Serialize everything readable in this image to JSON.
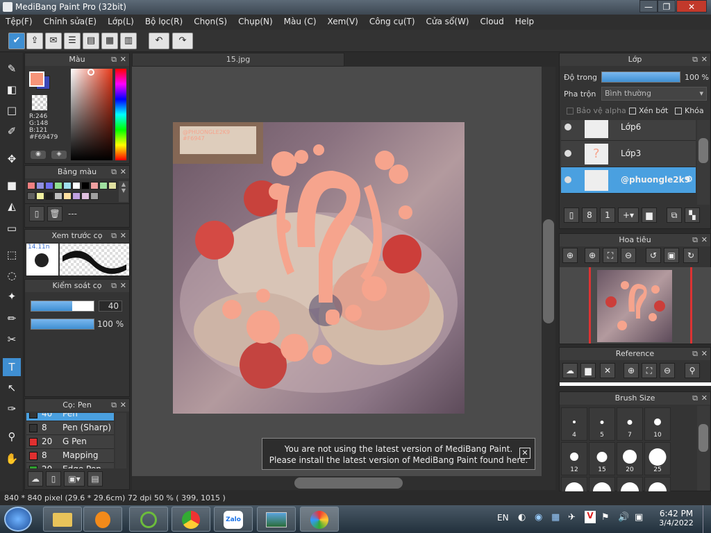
{
  "window": {
    "title": "MediBang Paint Pro (32bit)",
    "min": "—",
    "max": "❐",
    "close": "✕"
  },
  "menu": [
    "Tệp(F)",
    "Chỉnh sửa(E)",
    "Lớp(L)",
    "Bộ lọc(R)",
    "Chọn(S)",
    "Chụp(N)",
    "Màu (C)",
    "Xem(V)",
    "Công cụ(T)",
    "Cửa sổ(W)",
    "Cloud",
    "Help"
  ],
  "document": {
    "tab": "15.jpg",
    "watermark_1": "@PHUONGLE2K9",
    "watermark_2": "#F6947"
  },
  "color_panel": {
    "title": "Màu",
    "r": "R:246",
    "g": "G:148",
    "b": "B:121",
    "hex": "#F69479",
    "fg_color": "#f69479",
    "bg_color": "#3a48b8"
  },
  "palette_panel": {
    "title": "Bảng màu",
    "swatches": [
      "#f08080",
      "#9090e0",
      "#7070f0",
      "#90e090",
      "#a0e0f0",
      "#ffffff",
      "#000000",
      "#f0a0a0",
      "#a0e0a0",
      "#e0e0a0",
      "#606060",
      "#f0f0a0",
      "#202020",
      "#c0c0c0",
      "#ffe0a0",
      "#c0a0e0",
      "#e0c0e0",
      "#a0a0a0"
    ],
    "dash": "---"
  },
  "brush_preview": {
    "title": "Xem trước cọ",
    "size_label": "14.11n"
  },
  "brush_control": {
    "title": "Kiểm soát cọ",
    "size": "40",
    "opacity": "100 %",
    "size_fraction": 0.66,
    "opacity_fraction": 1.0
  },
  "brush_list": {
    "title": "Cọ: Pen",
    "items": [
      {
        "size": "40",
        "name": "Pen",
        "color": "#333333"
      },
      {
        "size": "8",
        "name": "Pen (Sharp)",
        "color": "#333333"
      },
      {
        "size": "20",
        "name": "G Pen",
        "color": "#e03030"
      },
      {
        "size": "8",
        "name": "Mapping Pen",
        "color": "#e03030"
      },
      {
        "size": "20",
        "name": "Edge Pen",
        "color": "#30a030"
      }
    ]
  },
  "layers": {
    "title": "Lớp",
    "opacity_label": "Độ trong",
    "opacity_value": "100 %",
    "opacity_fraction": 1.0,
    "blend_label": "Pha trộn",
    "blend_value": "Bình thường",
    "protect_alpha": "Bảo vệ alpha",
    "clipping": "Xén bớt",
    "lock": "Khóa",
    "items": [
      {
        "name": "Lớp6",
        "selected": false
      },
      {
        "name": "Lớp3",
        "selected": false
      },
      {
        "name": "@phuongle2k9",
        "selected": true
      }
    ]
  },
  "navigator": {
    "title": "Hoa tiêu"
  },
  "reference": {
    "title": "Reference"
  },
  "brush_size": {
    "title": "Brush Size",
    "sizes": [
      "4",
      "5",
      "7",
      "10",
      "12",
      "15",
      "20",
      "25",
      "",
      "",
      "",
      ""
    ]
  },
  "notice": {
    "line1": "You are not using the latest version of MediBang Paint.",
    "line2": "Please install the latest version of MediBang Paint found here.",
    "close": "✕"
  },
  "status": {
    "text": "840 * 840 pixel   (29.6 * 29.6cm)   72 dpi   50 %   ( 399, 1015 )"
  },
  "taskbar": {
    "lang": "EN",
    "time": "6:42 PM",
    "date": "3/4/2022",
    "tasks": [
      "explorer",
      "media",
      "chrome-like",
      "chrome",
      "zalo",
      "photos",
      "medibang"
    ]
  }
}
